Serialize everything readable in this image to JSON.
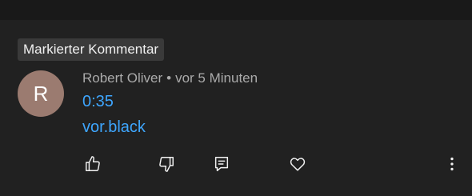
{
  "badge": {
    "label": "Markierter Kommentar"
  },
  "comment": {
    "avatar_letter": "R",
    "author": "Robert Oliver",
    "separator": "•",
    "time": "vor 5 Minuten",
    "timestamp_link": "0:35",
    "text_link": "vor.black"
  },
  "actions": [
    {
      "name": "like",
      "icon": "thumbs-up-icon"
    },
    {
      "name": "dislike",
      "icon": "thumbs-down-icon"
    },
    {
      "name": "reply",
      "icon": "reply-icon"
    },
    {
      "name": "heart",
      "icon": "heart-icon"
    },
    {
      "name": "more",
      "icon": "more-vert-icon"
    }
  ],
  "colors": {
    "background": "#212121",
    "link": "#3ea6ff",
    "avatar": "#9b7b70",
    "badge": "#3a3a3a"
  }
}
